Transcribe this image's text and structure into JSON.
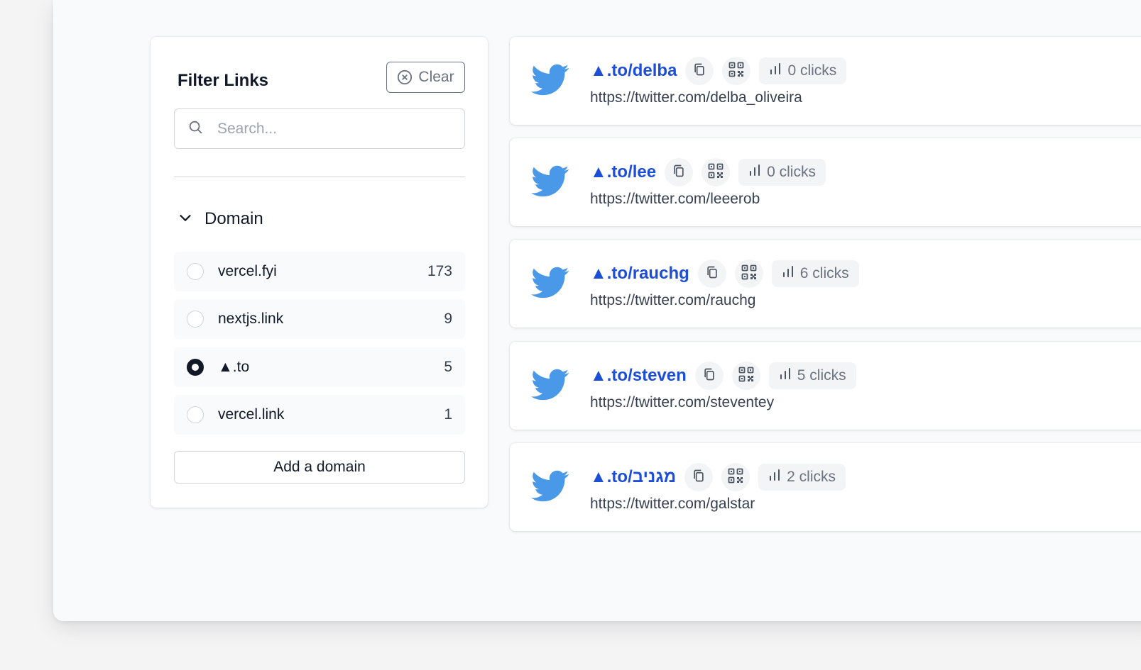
{
  "filter": {
    "title": "Filter Links",
    "clear_label": "Clear",
    "search_placeholder": "Search...",
    "domain_section_label": "Domain",
    "domains": [
      {
        "name": "vercel.fyi",
        "count": "173",
        "selected": false
      },
      {
        "name": "nextjs.link",
        "count": "9",
        "selected": false
      },
      {
        "name": "▲.to",
        "count": "5",
        "selected": true
      },
      {
        "name": "vercel.link",
        "count": "1",
        "selected": false
      }
    ],
    "add_domain_label": "Add a domain"
  },
  "links": [
    {
      "short": "▲.to/delba",
      "url": "https://twitter.com/delba_oliveira",
      "clicks": "0 clicks"
    },
    {
      "short": "▲.to/lee",
      "url": "https://twitter.com/leeerob",
      "clicks": "0 clicks"
    },
    {
      "short": "▲.to/rauchg",
      "url": "https://twitter.com/rauchg",
      "clicks": "6 clicks"
    },
    {
      "short": "▲.to/steven",
      "url": "https://twitter.com/steventey",
      "clicks": "5 clicks"
    },
    {
      "short": "▲.to/מגניב",
      "url": "https://twitter.com/galstar",
      "clicks": "2 clicks"
    }
  ],
  "icons": {
    "link_favicon": "twitter-icon",
    "copy": "copy-icon",
    "qr": "qr-code-icon",
    "stats": "bar-chart-icon",
    "search": "search-icon",
    "clear": "x-circle-icon",
    "collapse": "chevron-down-icon"
  },
  "colors": {
    "link_blue": "#1d4ed8",
    "twitter_blue": "#4a99e9",
    "pill_bg": "#f3f4f6"
  }
}
